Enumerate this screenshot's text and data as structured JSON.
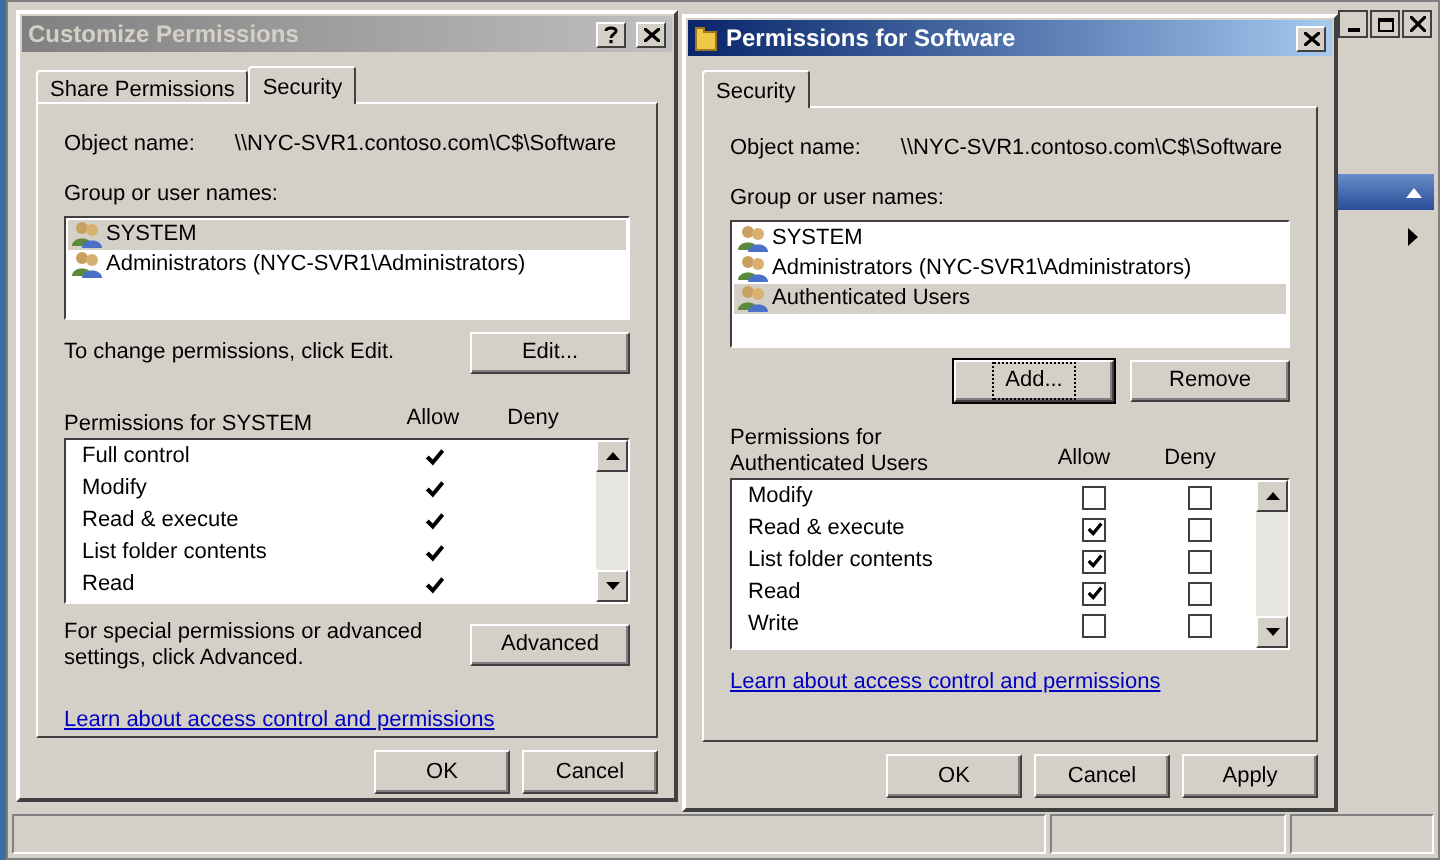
{
  "dialogs": [
    {
      "title": "Customize Permissions",
      "active": false,
      "title_buttons": [
        {
          "kind": "help"
        },
        {
          "kind": "close"
        }
      ],
      "tabs": [
        {
          "label": "Share Permissions",
          "selected": false
        },
        {
          "label": "Security",
          "selected": true
        }
      ],
      "object_label": "Object name:",
      "object_name": "\\\\NYC-SVR1.contoso.com\\C$\\Software",
      "group_label": "Group or user names:",
      "users": [
        {
          "name": "SYSTEM",
          "selected": true
        },
        {
          "name": "Administrators (NYC-SVR1\\Administrators)",
          "selected": false
        }
      ],
      "hint": "To change permissions, click Edit.",
      "user_buttons": [
        {
          "label": "Edit...",
          "focused": false
        }
      ],
      "permissions_label": "Permissions for SYSTEM",
      "allow_label": "Allow",
      "deny_label": "Deny",
      "permissions": [
        {
          "kind": "tick",
          "name": "Full control",
          "allow": true,
          "deny": false
        },
        {
          "kind": "tick",
          "name": "Modify",
          "allow": true,
          "deny": false
        },
        {
          "kind": "tick",
          "name": "Read & execute",
          "allow": true,
          "deny": false
        },
        {
          "kind": "tick",
          "name": "List folder contents",
          "allow": true,
          "deny": false
        },
        {
          "kind": "tick",
          "name": "Read",
          "allow": true,
          "deny": false
        }
      ],
      "advanced_hint": "For special permissions or advanced settings, click Advanced.",
      "advanced_button": "Advanced",
      "link": "Learn about access control and permissions",
      "footer_buttons": [
        "OK",
        "Cancel"
      ]
    },
    {
      "title": "Permissions for Software",
      "active": true,
      "title_buttons": [
        {
          "kind": "close"
        }
      ],
      "tabs": [
        {
          "label": "Security",
          "selected": true
        }
      ],
      "object_label": "Object name:",
      "object_name": "\\\\NYC-SVR1.contoso.com\\C$\\Software",
      "group_label": "Group or user names:",
      "users": [
        {
          "name": "SYSTEM",
          "selected": false
        },
        {
          "name": "Administrators (NYC-SVR1\\Administrators)",
          "selected": false
        },
        {
          "name": "Authenticated Users",
          "selected": true
        }
      ],
      "user_buttons": [
        {
          "label": "Add...",
          "focused": true
        },
        {
          "label": "Remove",
          "focused": false
        }
      ],
      "permissions_label": "Permissions for Authenticated Users",
      "allow_label": "Allow",
      "deny_label": "Deny",
      "permissions": [
        {
          "kind": "checkbox",
          "name": "Modify",
          "allow": false,
          "deny": false
        },
        {
          "kind": "checkbox",
          "name": "Read & execute",
          "allow": true,
          "deny": false
        },
        {
          "kind": "checkbox",
          "name": "List folder contents",
          "allow": true,
          "deny": false
        },
        {
          "kind": "checkbox",
          "name": "Read",
          "allow": true,
          "deny": false
        },
        {
          "kind": "checkbox",
          "name": "Write",
          "allow": false,
          "deny": false
        }
      ],
      "link": "Learn about access control and permissions",
      "footer_buttons": [
        "OK",
        "Cancel",
        "Apply"
      ]
    }
  ]
}
